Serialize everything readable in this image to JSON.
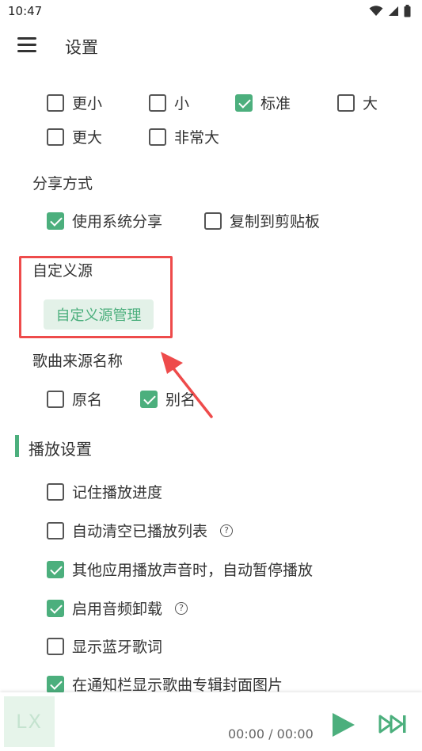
{
  "status_bar": {
    "time": "10:47"
  },
  "app_bar": {
    "title": "设置"
  },
  "font_size": {
    "options": [
      {
        "label": "更小",
        "checked": false
      },
      {
        "label": "小",
        "checked": false
      },
      {
        "label": "标准",
        "checked": true
      },
      {
        "label": "大",
        "checked": false
      },
      {
        "label": "更大",
        "checked": false
      },
      {
        "label": "非常大",
        "checked": false
      }
    ]
  },
  "share": {
    "title": "分享方式",
    "options": [
      {
        "label": "使用系统分享",
        "checked": true
      },
      {
        "label": "复制到剪贴板",
        "checked": false
      }
    ]
  },
  "custom_source": {
    "title": "自定义源",
    "button_label": "自定义源管理"
  },
  "source_name": {
    "title": "歌曲来源名称",
    "options": [
      {
        "label": "原名",
        "checked": false
      },
      {
        "label": "别名",
        "checked": true
      }
    ]
  },
  "playback": {
    "title": "播放设置",
    "options": [
      {
        "label": "记住播放进度",
        "checked": false,
        "help": false
      },
      {
        "label": "自动清空已播放列表",
        "checked": false,
        "help": true
      },
      {
        "label": "其他应用播放声音时，自动暂停播放",
        "checked": true,
        "help": false
      },
      {
        "label": "启用音频卸载",
        "checked": true,
        "help": true
      },
      {
        "label": "显示蓝牙歌词",
        "checked": false,
        "help": false
      },
      {
        "label": "在通知栏显示歌曲专辑封面图片",
        "checked": true,
        "help": false
      }
    ],
    "help_glyph": "?"
  },
  "player": {
    "cover_text": "LX",
    "time": "00:00 / 00:00"
  },
  "colors": {
    "accent": "#4caf7d",
    "highlight": "#ee4b4b"
  }
}
